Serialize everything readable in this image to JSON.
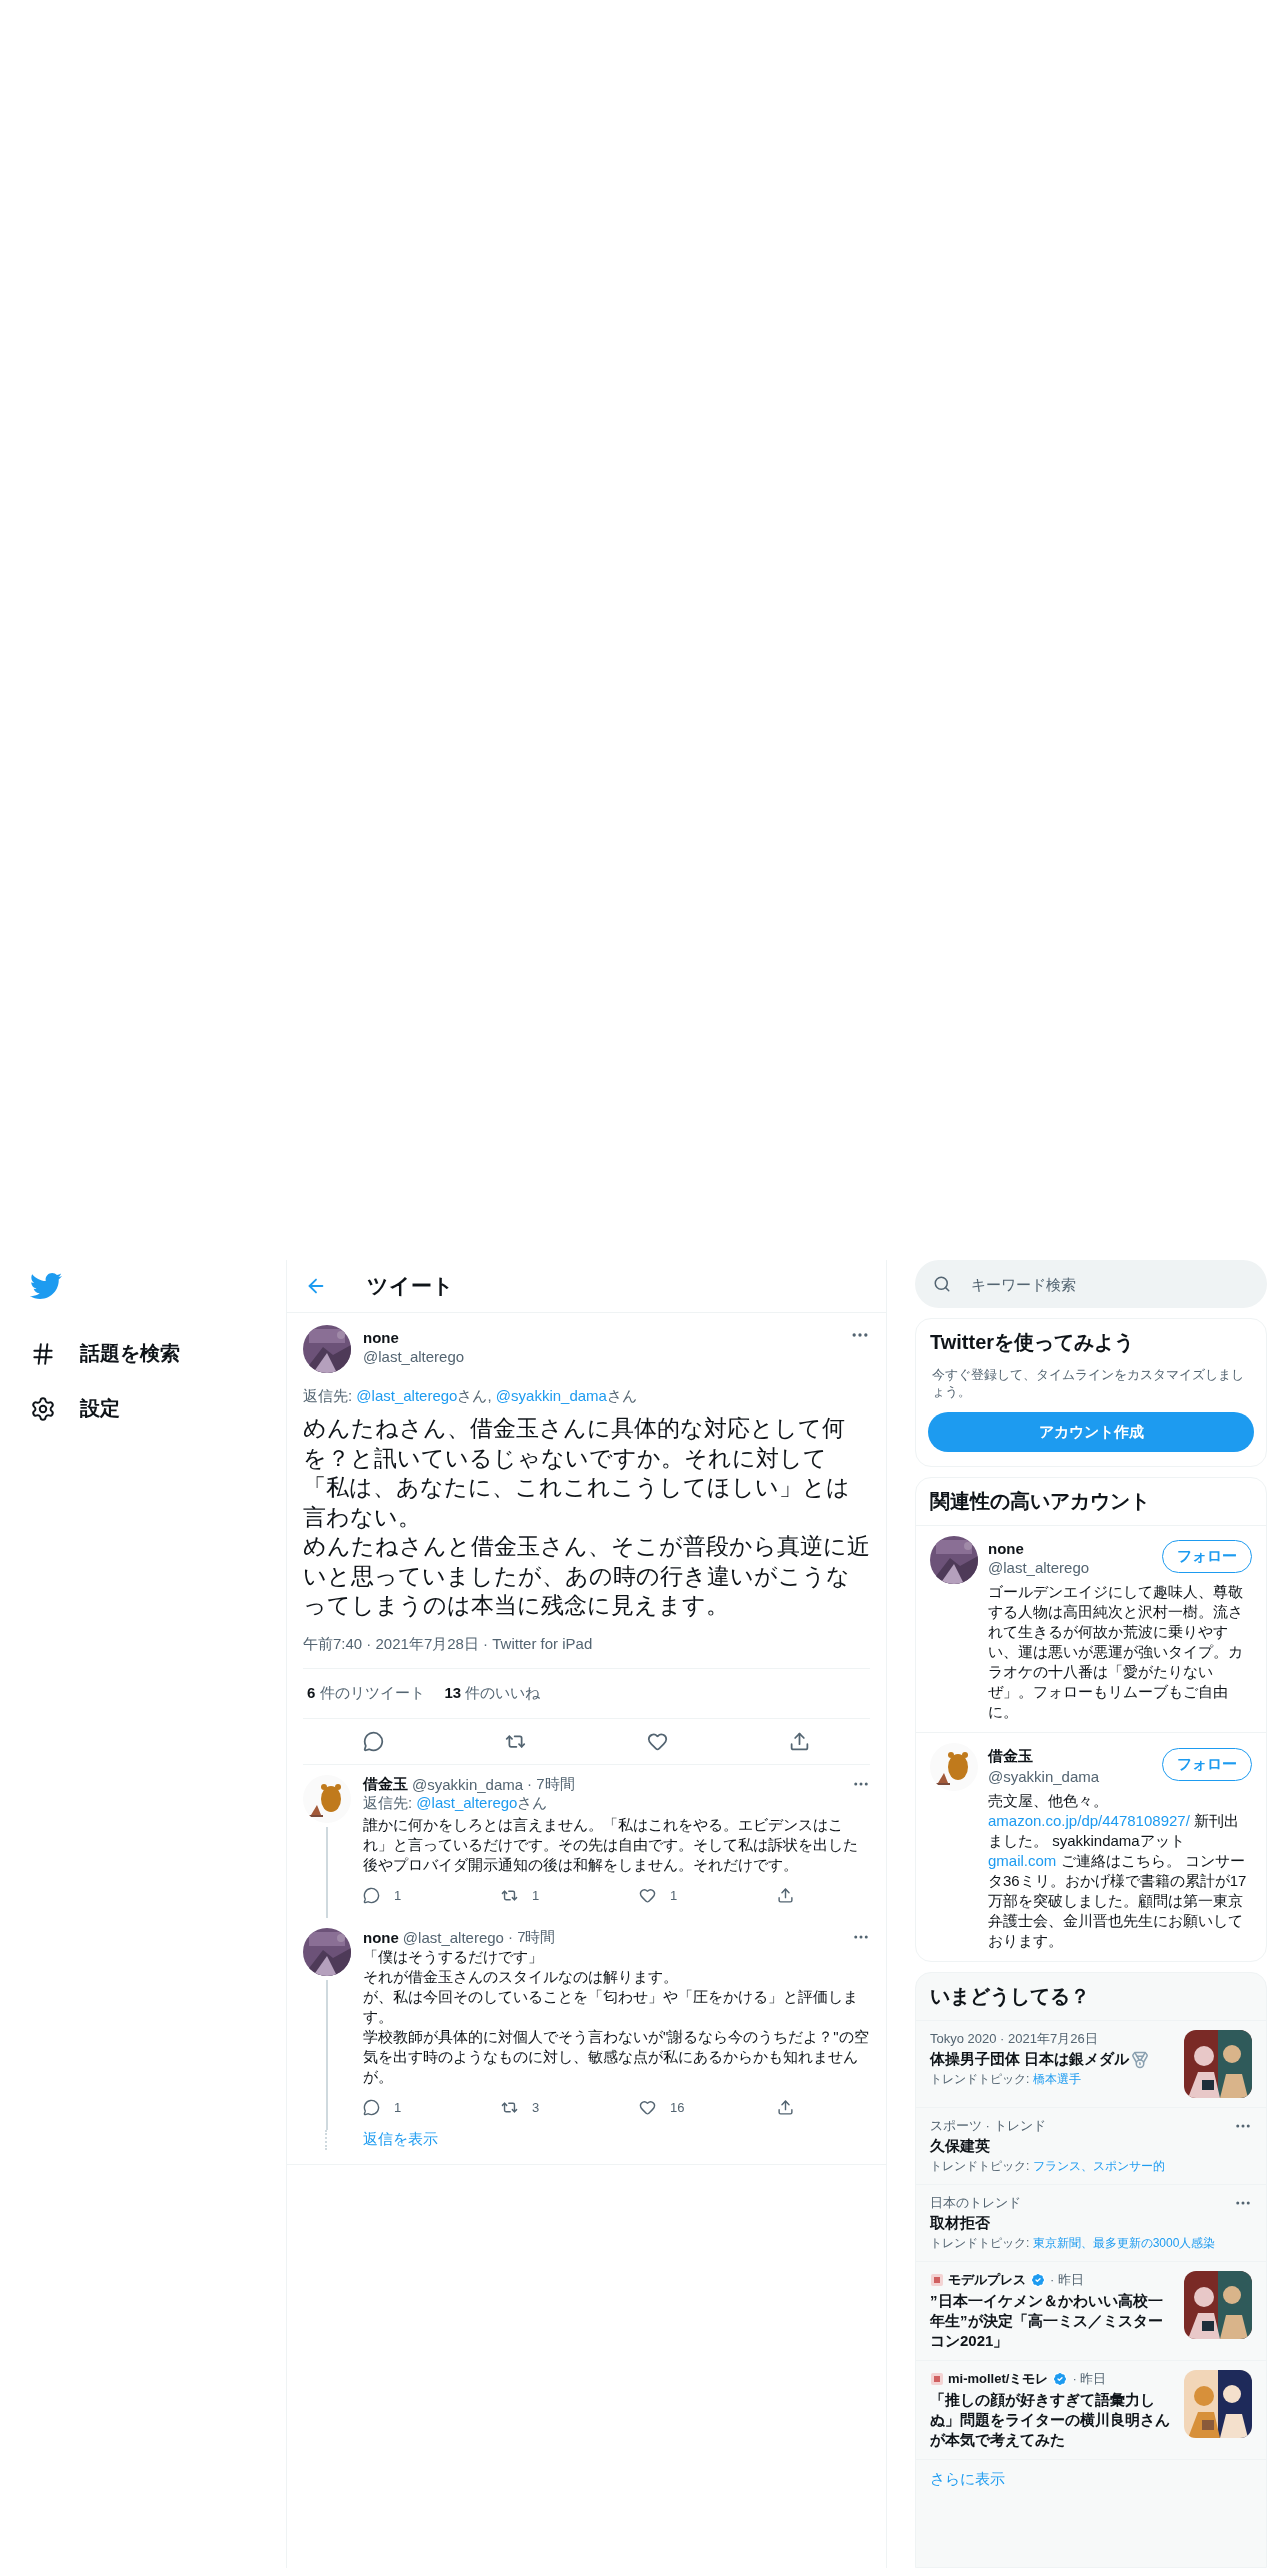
{
  "nav": {
    "items": [
      {
        "kind": "hash",
        "label": "話題を検索"
      },
      {
        "kind": "gear",
        "label": "設定"
      }
    ]
  },
  "header": {
    "title": "ツイート"
  },
  "main_tweet": {
    "name": "none",
    "handle": "@last_alterego",
    "reply_to": [
      {
        "kind": "plain",
        "text": "返信先: "
      },
      {
        "kind": "link",
        "text": "@last_alterego"
      },
      {
        "kind": "plain",
        "text": "さん, "
      },
      {
        "kind": "link",
        "text": "@syakkin_dama"
      },
      {
        "kind": "plain",
        "text": "さん"
      }
    ],
    "body": [
      "めんたねさん、借金玉さんに具体的な対応として何を？と訊いているじゃないですか。それに対して「私は、あなたに、これこれこうしてほしい」とは言わない。",
      "めんたねさんと借金玉さん、そこが普段から真逆に近いと思っていましたが、あの時の行き違いがこうなってしまうのは本当に残念に見えます。"
    ],
    "meta": "午前7:40 · 2021年7月28日 · Twitter for iPad",
    "stats": [
      {
        "count": "6",
        "label": "件のリツイート"
      },
      {
        "count": "13",
        "label": "件のいいね"
      }
    ]
  },
  "replies": [
    {
      "name": "借金玉",
      "handle": "@syakkin_dama",
      "time": "· 7時間",
      "reply_to": [
        {
          "kind": "plain",
          "text": "返信先: "
        },
        {
          "kind": "link",
          "text": "@last_alterego"
        },
        {
          "kind": "plain",
          "text": "さん"
        }
      ],
      "body": [
        "誰かに何かをしろとは言えません。「私はこれをやる。エビデンスはこれ」と言っているだけです。その先は自由です。そして私は訴状を出した後やプロバイダ開示通知の後は和解をしません。それだけです。"
      ],
      "counts": {
        "reply": "1",
        "retweet": "1",
        "like": "1"
      }
    },
    {
      "name": "none",
      "handle": "@last_alterego",
      "time": "· 7時間",
      "body": [
        "「僕はそうするだけです」",
        "それが借金玉さんのスタイルなのは解ります。",
        "が、私は今回そのしていることを「匂わせ」や「圧をかける」と評価します。",
        "学校教師が具体的に対個人でそう言わないが\"謝るなら今のうちだよ？\"の空気を出す時のようなものに対し、敏感な点が私にあるからかも知れませんが。"
      ],
      "counts": {
        "reply": "1",
        "retweet": "3",
        "like": "16"
      }
    }
  ],
  "show_replies": "返信を表示",
  "search": {
    "placeholder": "キーワード検索"
  },
  "signup": {
    "title": "Twitterを使ってみよう",
    "description": "今すぐ登録して、タイムラインをカスタマイズしましょう。",
    "button": "アカウント作成"
  },
  "related": {
    "title": "関連性の高いアカウント",
    "accounts": [
      {
        "name": "none",
        "handle": "@last_alterego",
        "follow": "フォロー",
        "bio": [
          {
            "kind": "plain",
            "text": "ゴールデンエイジにして趣味人、尊敬する人物は高田純次と沢村一樹。流されて生きるが何故か荒波に乗りやすい、運は悪いが悪運が強いタイプ。カラオケの十八番は「愛がたりないぜ」。フォローもリムーブもご自由に。"
          }
        ]
      },
      {
        "name": "借金玉",
        "handle": "@syakkin_dama",
        "follow": "フォロー",
        "bio": [
          {
            "kind": "plain",
            "text": "売文屋、他色々。"
          },
          {
            "kind": "link",
            "text": "amazon.co.jp/dp/4478108927/"
          },
          {
            "kind": "plain",
            "text": " 新刊出ました。 syakkindamaアット"
          },
          {
            "kind": "link",
            "text": "gmail.com"
          },
          {
            "kind": "plain",
            "text": " ご連絡はこちら。 コンサータ36ミリ。おかげ様で書籍の累計が17万部を突破しました。顧問は第一東京弁護士会、金川晋也先生にお願いしております。"
          }
        ]
      }
    ]
  },
  "trends": {
    "title": "いまどうしてる？",
    "items": [
      {
        "kind": "trend",
        "context": "Tokyo 2020 · 2021年7月26日",
        "name": "体操男子団体 日本は銀メダル",
        "medal": true,
        "topic_label": "トレンドトピック: ",
        "topics": "橋本選手",
        "picture": true,
        "more": false
      },
      {
        "kind": "trend",
        "context": "スポーツ · トレンド",
        "name": "久保建英",
        "topic_label": "トレンドトピック: ",
        "topics": "フランス、スポンサー的",
        "picture": false,
        "more": true
      },
      {
        "kind": "trend",
        "context": "日本のトレンド",
        "name": "取材拒否",
        "topic_label": "トレンドトピック: ",
        "topics": "東京新聞、最多更新の3000人感染",
        "picture": false,
        "more": true
      },
      {
        "kind": "news",
        "source": "モデルプレス",
        "verified": true,
        "time": "· 昨日",
        "headline": "”日本一イケメン＆かわいい高校一年生”が決定「高一ミス／ミスターコン2021」",
        "picture": true
      },
      {
        "kind": "news",
        "source": "mi-mollet/ミモレ",
        "verified": true,
        "time": "· 昨日",
        "headline": "「推しの顔が好きすぎて語彙力しぬ」問題をライターの横川良明さんが本気で考えてみた",
        "picture": true
      }
    ],
    "more_link": "さらに表示"
  }
}
